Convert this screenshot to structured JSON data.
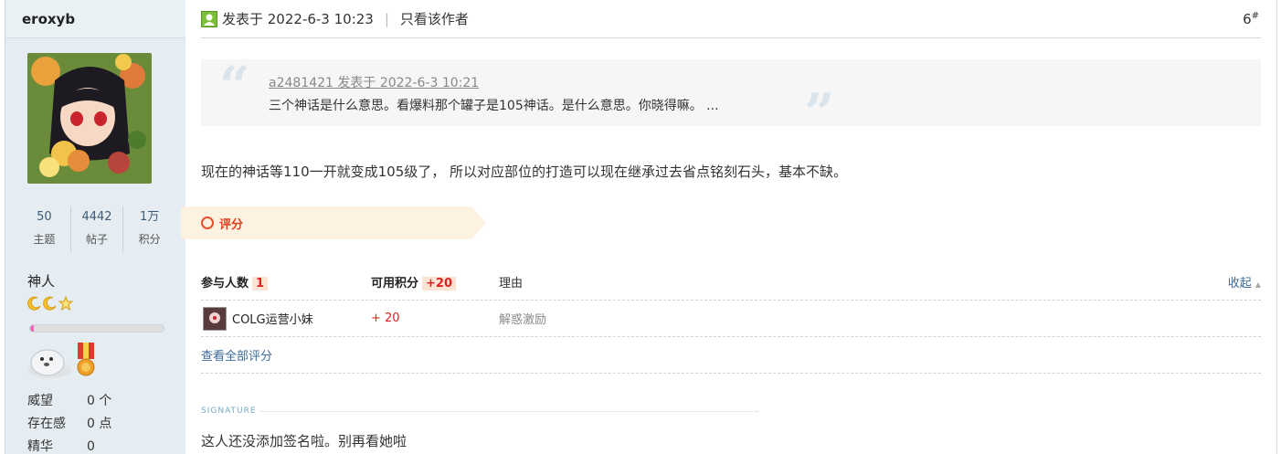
{
  "user": {
    "name": "eroxyb",
    "stats": [
      {
        "value": "50",
        "label": "主题"
      },
      {
        "value": "4442",
        "label": "帖子"
      },
      {
        "value": "1万",
        "label": "积分"
      }
    ],
    "group": "神人",
    "level_progress": 0.03,
    "info": [
      {
        "key": "威望",
        "value": "0 个"
      },
      {
        "key": "存在感",
        "value": "0 点"
      },
      {
        "key": "精华",
        "value": "0"
      }
    ]
  },
  "post": {
    "posted_label": "发表于 2022-6-3 10:23",
    "author_only": "只看该作者",
    "floor_number": "6",
    "floor_suffix": "#",
    "quote": {
      "meta": "a2481421 发表于 2022-6-3 10:21",
      "text": "三个神话是什么意思。看爆料那个罐子是105神话。是什么意思。你晓得嘛。 ..."
    },
    "content": "现在的神话等110一开就变成105级了， 所以对应部位的打造可以现在继承过去省点铭刻石头，基本不缺。"
  },
  "rating": {
    "tag_label": "评分",
    "header": {
      "participants_label": "参与人数",
      "participants_count": "1",
      "points_label": "可用积分",
      "points_total": "+20",
      "reason_label": "理由",
      "collapse_label": "收起"
    },
    "rows": [
      {
        "user": "COLG运营小妹",
        "points": "+ 20",
        "reason": "解惑激励"
      }
    ],
    "view_all": "查看全部评分"
  },
  "signature": {
    "label": "SIGNATURE",
    "text": "这人还没添加签名啦。别再看她啦"
  }
}
